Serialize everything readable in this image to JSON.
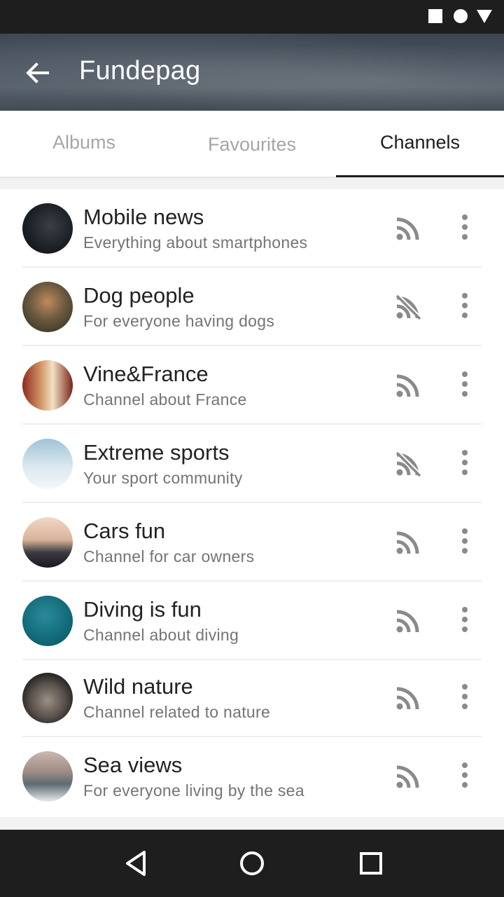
{
  "status_bar": {
    "icons": [
      "square-icon",
      "circle-icon",
      "triangle-icon"
    ]
  },
  "app_bar": {
    "title": "Fundepag",
    "back_icon": "arrow-left-icon"
  },
  "tabs": [
    {
      "label": "Albums",
      "active": false
    },
    {
      "label": "Favourites",
      "active": false
    },
    {
      "label": "Channels",
      "active": true
    }
  ],
  "channels": [
    {
      "title": "Mobile news",
      "subtitle": "Everything about smartphones",
      "subscribed": true
    },
    {
      "title": "Dog people",
      "subtitle": "For everyone having dogs",
      "subscribed": false
    },
    {
      "title": "Vine&France",
      "subtitle": "Channel about France",
      "subscribed": true
    },
    {
      "title": "Extreme sports",
      "subtitle": "Your sport community",
      "subscribed": false
    },
    {
      "title": "Cars fun",
      "subtitle": "Channel for car owners",
      "subscribed": true
    },
    {
      "title": "Diving is fun",
      "subtitle": "Channel about diving",
      "subscribed": true
    },
    {
      "title": "Wild nature",
      "subtitle": "Channel related to nature",
      "subscribed": true
    },
    {
      "title": "Sea views",
      "subtitle": "For everyone living by the sea",
      "subscribed": true
    }
  ],
  "colors": {
    "accent": "#1d1d1d",
    "inactive_tab": "#a6a6a6",
    "icon": "#8a8a8a"
  },
  "nav_bar": {
    "icons": [
      "back-triangle-icon",
      "home-circle-icon",
      "recents-square-icon"
    ]
  }
}
